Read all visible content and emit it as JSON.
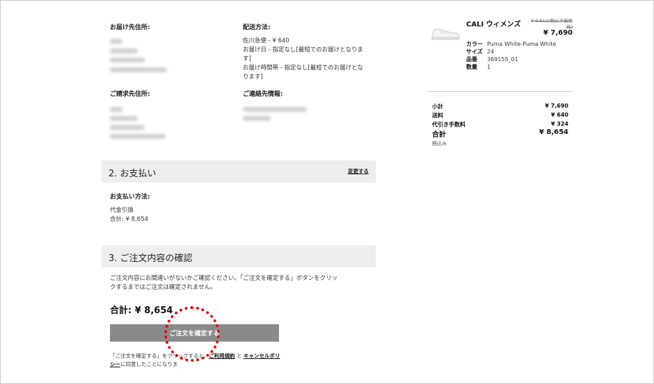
{
  "shipping_address": {
    "label": "お届け先住所:"
  },
  "shipping_method": {
    "label": "配送方法:",
    "lines": [
      "佐川急便 - ¥ 640",
      "お届け日 - 指定なし[最短でのお届けとなりま",
      "す]",
      "お届け時間帯 - 指定なし[最短でのお届けとな",
      "ります]"
    ]
  },
  "billing_address": {
    "label": "ご請求先住所:"
  },
  "contact": {
    "label": "ご連絡先情報:"
  },
  "payment": {
    "title": "2. お支払い",
    "change_link": "変更する",
    "method_label": "お支払い方法:",
    "method_value": "代金引換",
    "total_line": "合計: ¥ 8,654"
  },
  "confirm": {
    "title": "3. ご注文内容の確認",
    "message_line1": "ご注文内容にお間違いがないかご確認ください。「ご注文を確定する」ボタンをクリッ",
    "message_line2": "クするまではご注文は確定されません。",
    "total": "合計: ¥ 8,654",
    "button_label": "ご注文を確定する",
    "terms_pre": "「ご注文を確定する」をクリックすると、",
    "terms_link1": "ご利用規約",
    "terms_mid": " と ",
    "terms_link2": "キャンセルポリシー",
    "terms_post": "に同意したことになりま"
  },
  "product": {
    "name": "CALI ウィメンズ",
    "price_old_line1": "¥ 9,612(税込下価格",
    "price_old_line2": "格)",
    "price_new": "¥ 7,690",
    "attributes": [
      {
        "label": "カラー",
        "value": "Puma White-Puma White"
      },
      {
        "label": "サイズ",
        "value": "24"
      },
      {
        "label": "品番",
        "value": "369155_01"
      },
      {
        "label": "数量",
        "value": "1"
      }
    ]
  },
  "summary": {
    "subtotal_label": "小計",
    "subtotal_value": "¥ 7,690",
    "shipping_label": "送料",
    "shipping_value": "¥ 640",
    "cod_label": "代引き手数料",
    "cod_value": "¥ 324",
    "total_label": "合計",
    "total_value": "¥ 8,654",
    "tax_note": "税込み"
  },
  "colors": {
    "section_bg": "#eeeeee",
    "button_bg": "#8a8a8a",
    "highlight_red": "#e60000"
  }
}
